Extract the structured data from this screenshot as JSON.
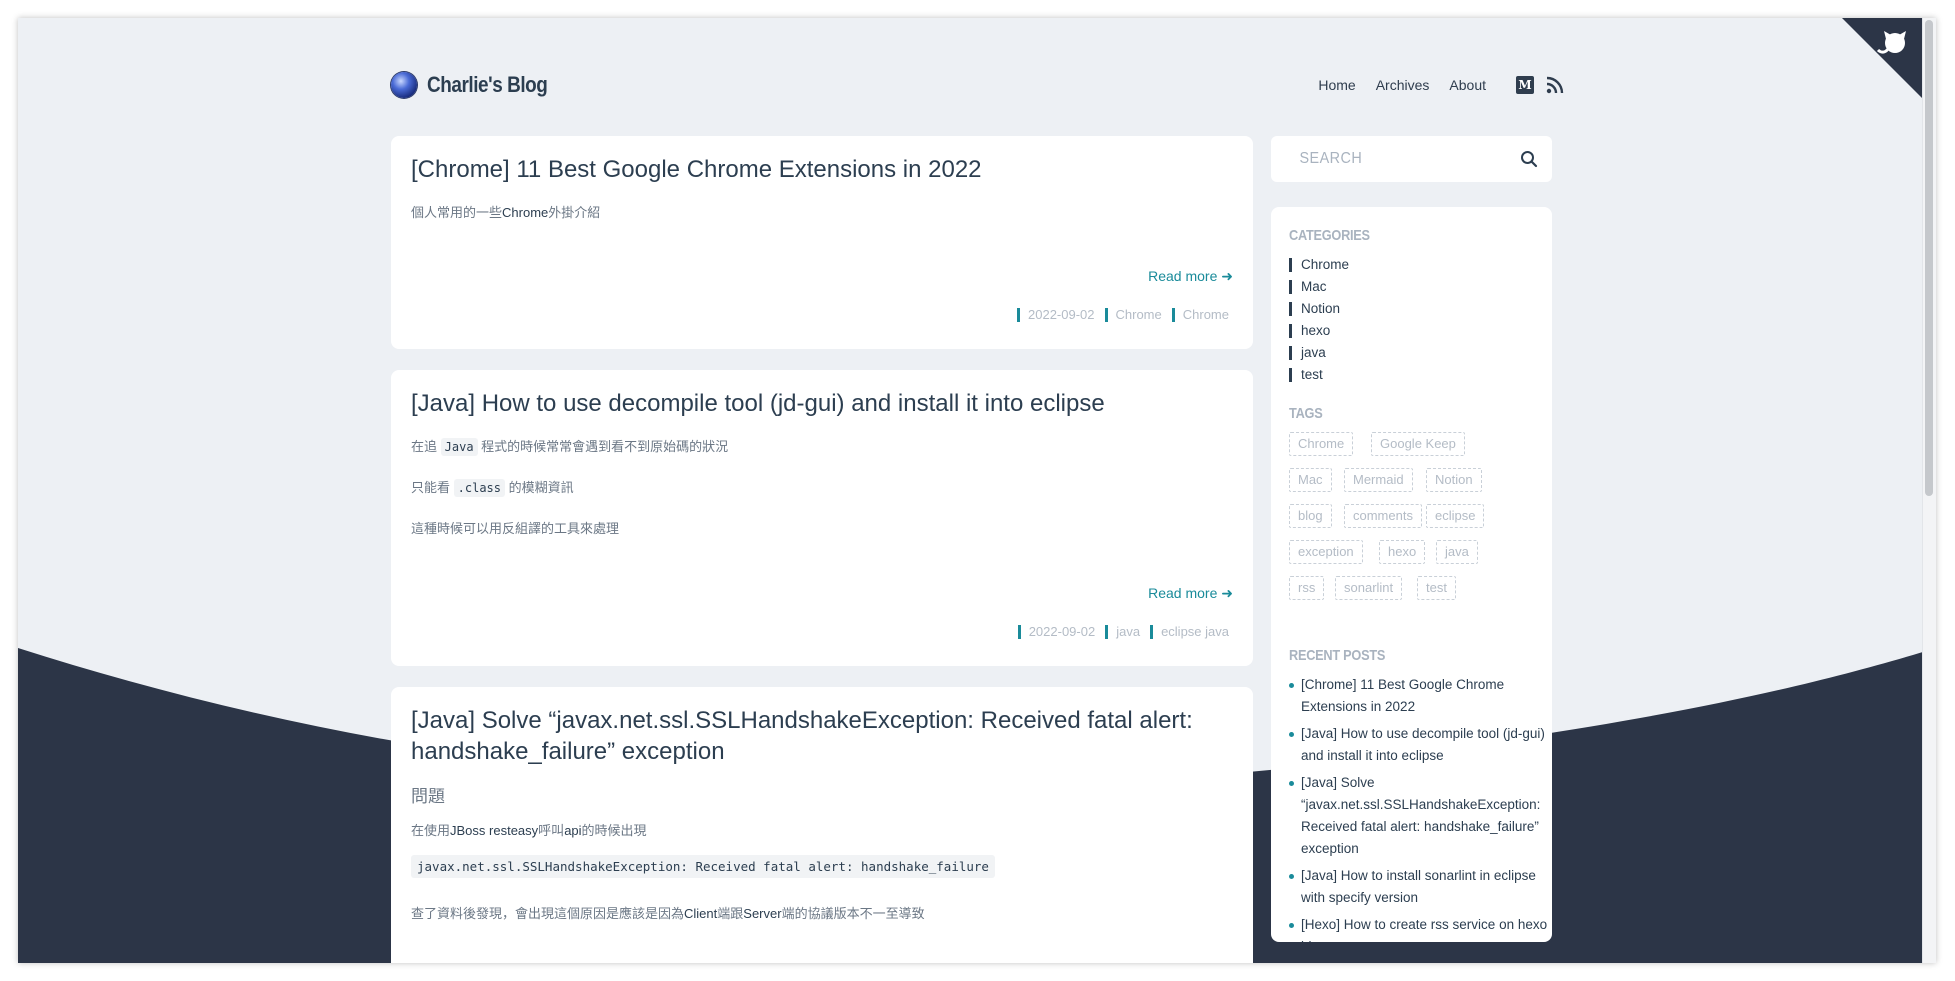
{
  "site": {
    "title": "Charlie's Blog",
    "nav": [
      "Home",
      "Archives",
      "About"
    ],
    "medium_icon_letter": "M",
    "icons": [
      "logo-ball-icon",
      "medium-icon",
      "rss-icon",
      "github-cat-icon",
      "search-icon",
      "arrow-right-icon"
    ]
  },
  "colors": {
    "accent": "#1a8b9a",
    "dark_wave": "#2c3547",
    "background": "#edf0f4",
    "text": "#2c3e50"
  },
  "posts": [
    {
      "title": "[Chrome] 11 Best Google Chrome Extensions in 2022",
      "excerpt_pre": "個人常用的一些",
      "excerpt_em": "Chrome",
      "excerpt_post": "外掛介紹",
      "read_more": "Read more ➜",
      "date": "2022-09-02",
      "category": "Chrome",
      "tags": "Chrome"
    },
    {
      "title": "[Java] How to use decompile tool (jd-gui) and install it into eclipse",
      "line1_pre": "在追",
      "line1_code": "Java",
      "line1_post": "程式的時候常常會遇到看不到原始碼的狀況",
      "line2_pre": "只能看",
      "line2_code": ".class",
      "line2_post": "的模糊資訊",
      "line3": "這種時候可以用反組譯的工具來處理",
      "read_more": "Read more ➜",
      "date": "2022-09-02",
      "category": "java",
      "tags": "eclipse java"
    },
    {
      "title": "[Java] Solve “javax.net.ssl.SSLHandshakeException: Received fatal alert: handshake_failure” exception",
      "subheading": "問題",
      "line1_pre": "在使用",
      "line1_em": "JBoss resteasy",
      "line1_mid": "呼叫",
      "line1_em2": "api",
      "line1_post": "的時候出現",
      "code": "javax.net.ssl.SSLHandshakeException: Received fatal alert: handshake_failure",
      "line3_pre": "查了資料後發現，會出現這個原因是應該是因為",
      "line3_em": "Client",
      "line3_mid": "端跟",
      "line3_em2": "Server",
      "line3_post": "端的協議版本不一至導致"
    }
  ],
  "sidebar": {
    "search_placeholder": "SEARCH",
    "categories_heading": "CATEGORIES",
    "categories": [
      "Chrome",
      "Mac",
      "Notion",
      "hexo",
      "java",
      "test"
    ],
    "tags_heading": "TAGS",
    "tags": [
      [
        "Chrome",
        "Google Keep"
      ],
      [
        "Mac",
        "Mermaid",
        "Notion"
      ],
      [
        "blog",
        "comments",
        "eclipse"
      ],
      [
        "exception",
        "hexo",
        "java"
      ],
      [
        "rss",
        "sonarlint",
        "test"
      ]
    ],
    "recent_heading": "RECENT POSTS",
    "recent": [
      "[Chrome] 11 Best Google Chrome Extensions in 2022",
      "[Java] How to use decompile tool (jd-gui) and install it into eclipse",
      "[Java] Solve “javax.net.ssl.SSLHandshakeException: Received fatal alert: handshake_failure” exception",
      "[Java] How to install sonarlint in eclipse with specify version",
      "[Hexo] How to create rss service on hexo blog"
    ]
  }
}
